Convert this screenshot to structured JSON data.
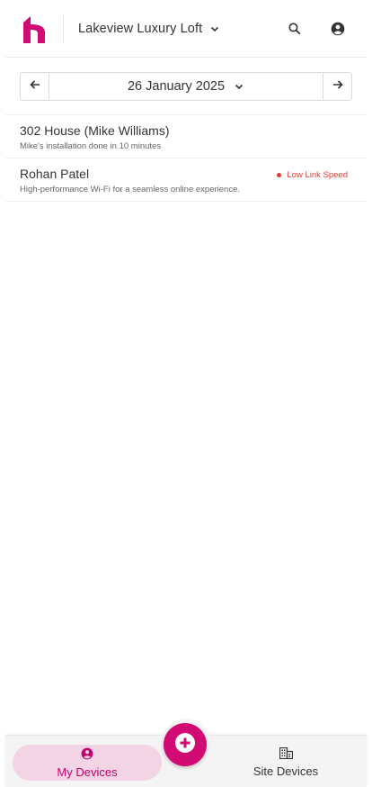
{
  "header": {
    "site_name": "Lakeview Luxury Loft"
  },
  "date_bar": {
    "date_label": "26 January 2025"
  },
  "devices": [
    {
      "name": "302 House (Mike Williams)",
      "description": "Mike's installation done in 10 minutes",
      "status": ""
    },
    {
      "name": "Rohan Patel",
      "description": "High-performance Wi-Fi for a seamless online experience.",
      "status": "Low Link Speed"
    }
  ],
  "bottom_nav": {
    "my_devices_label": "My Devices",
    "site_devices_label": "Site Devices",
    "active_tab": "My Devices"
  },
  "colors": {
    "brand": "#d10a74",
    "active_tab_bg": "#f2d4e5",
    "status_error": "#e53935"
  },
  "icons": {
    "logo": "brand-logo",
    "search": "search-icon",
    "account": "account-circle-icon",
    "prev": "arrow-left-icon",
    "next": "arrow-right-icon",
    "add": "add-circle-icon",
    "site_devices": "building-icon"
  }
}
